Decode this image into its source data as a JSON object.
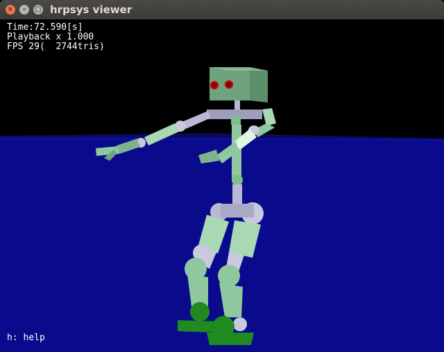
{
  "window": {
    "title": "hrpsys viewer"
  },
  "colors": {
    "floor": "#0a0a8c",
    "sky": "#000000",
    "robot_green": "#6fa37f",
    "robot_joint": "#b9b9d3",
    "foot": "#1f8a1f"
  },
  "hud": {
    "time": "Time:72.590[s]",
    "playback": "Playback x 1.000",
    "fps": "FPS 29(  2744tris)",
    "help": "h: help"
  },
  "icons": {
    "close": "close-icon",
    "minimize": "minimize-icon",
    "maximize": "maximize-icon"
  }
}
